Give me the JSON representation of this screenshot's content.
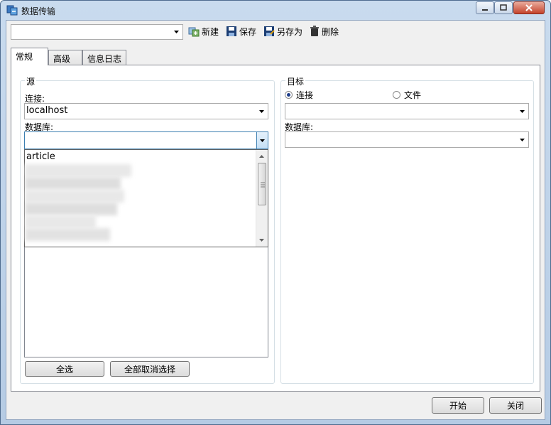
{
  "window": {
    "title": "数据传输"
  },
  "toolbar": {
    "profile_combo_value": "",
    "new_label": "新建",
    "save_label": "保存",
    "save_as_label": "另存为",
    "delete_label": "删除"
  },
  "tabs": [
    {
      "label": "常规",
      "active": true
    },
    {
      "label": "高级",
      "active": false
    },
    {
      "label": "信息日志",
      "active": false
    }
  ],
  "source": {
    "group_title": "源",
    "connection_label": "连接:",
    "connection_value": "localhost",
    "database_label": "数据库:",
    "database_value": "",
    "dropdown_items": [
      "article",
      "",
      "",
      "",
      "",
      ""
    ],
    "select_all_label": "全选",
    "deselect_all_label": "全部取消选择"
  },
  "target": {
    "group_title": "目标",
    "radio_connection_label": "连接",
    "radio_file_label": "文件",
    "selected_radio": "connection",
    "connection_value": "",
    "database_label": "数据库:",
    "database_value": ""
  },
  "footer": {
    "start_label": "开始",
    "close_label": "关闭"
  },
  "colors": {
    "frame": "#c9dbee",
    "close_button": "#c4432c",
    "focus_border": "#3c7fb1"
  }
}
